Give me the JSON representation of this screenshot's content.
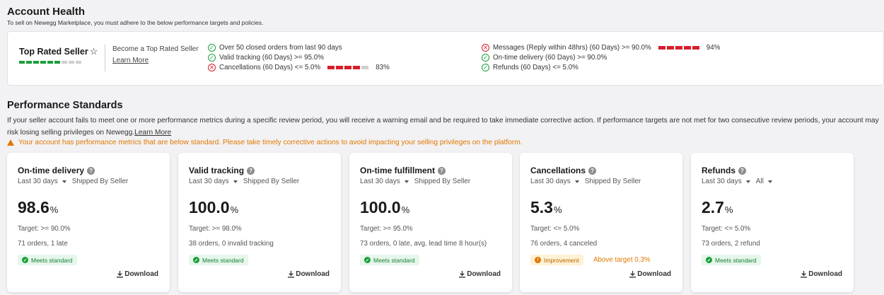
{
  "account_health": {
    "title": "Account Health",
    "subtitle": "To sell on Newegg Marketplace, you must adhere to the below performance targets and policies."
  },
  "top_rated": {
    "name": "Top Rated Seller",
    "star_icon": "star-outline-icon",
    "progress_segments": 9,
    "progress_filled": 6,
    "become_text": "Become a Top Rated Seller",
    "learn_more": "Learn More",
    "criteria_left": [
      {
        "status": "ok",
        "text": "Over 50 closed orders from last 90 days"
      },
      {
        "status": "ok",
        "text": "Valid tracking (60 Days) >= 95.0%"
      },
      {
        "status": "bad",
        "text": "Cancellations (60 Days) <= 5.0%",
        "bar_red": 4,
        "bar_total": 5,
        "value": "83%"
      }
    ],
    "criteria_right": [
      {
        "status": "bad",
        "text": "Messages (Reply within 48hrs) (60 Days) >= 90.0%",
        "bar_red": 5,
        "bar_total": 5,
        "value": "94%"
      },
      {
        "status": "ok",
        "text": "On-time delivery (60 Days) >= 90.0%"
      },
      {
        "status": "ok",
        "text": "Refunds (60 Days) <= 5.0%"
      }
    ],
    "colors": {
      "green": "#1a9e3a",
      "red": "#d81e2c",
      "gray": "#d0d0d0"
    }
  },
  "performance": {
    "title": "Performance Standards",
    "description": "If your seller account fails to meet one or more performance metrics during a specific review period, you will receive a warning email and be required to take immediate corrective action. If performance targets are not met for two consecutive review periods, your account may risk losing selling privileges on Newegg.",
    "learn_more": "Learn More",
    "warning": "Your account has performance metrics that are below standard. Please take timely corrective actions to avoid impacting your selling privileges on the platform.",
    "warning_color": "#e07800"
  },
  "cards": [
    {
      "title": "On-time delivery",
      "period": "Last 30 days",
      "filter": "Shipped By Seller",
      "value": "98.6",
      "unit": "%",
      "target": "Target: >= 90.0%",
      "detail": "71 orders, 1 late",
      "badge": "Meets standard",
      "badge_type": "ok",
      "extra": "",
      "download": "Download"
    },
    {
      "title": "Valid tracking",
      "period": "Last 30 days",
      "filter": "Shipped By Seller",
      "value": "100.0",
      "unit": "%",
      "target": "Target: >= 98.0%",
      "detail": "38 orders, 0 invalid tracking",
      "badge": "Meets standard",
      "badge_type": "ok",
      "extra": "",
      "download": "Download"
    },
    {
      "title": "On-time fulfillment",
      "period": "Last 30 days",
      "filter": "Shipped By Seller",
      "value": "100.0",
      "unit": "%",
      "target": "Target: >= 95.0%",
      "detail": "73 orders, 0 late, avg. lead time 8 hour(s)",
      "badge": "Meets standard",
      "badge_type": "ok",
      "extra": "",
      "download": "Download"
    },
    {
      "title": "Cancellations",
      "period": "Last 30 days",
      "filter": "Shipped By Seller",
      "value": "5.3",
      "unit": "%",
      "target": "Target: <= 5.0%",
      "detail": "76 orders, 4 canceled",
      "badge": "Improvement",
      "badge_type": "warn",
      "extra": "Above target 0.3%",
      "download": "Download"
    },
    {
      "title": "Refunds",
      "period": "Last 30 days",
      "filter": "All",
      "filter_has_caret": true,
      "value": "2.7",
      "unit": "%",
      "target": "Target: <= 5.0%",
      "detail": "73 orders, 2 refund",
      "badge": "Meets standard",
      "badge_type": "ok",
      "extra": "",
      "download": "Download"
    }
  ]
}
